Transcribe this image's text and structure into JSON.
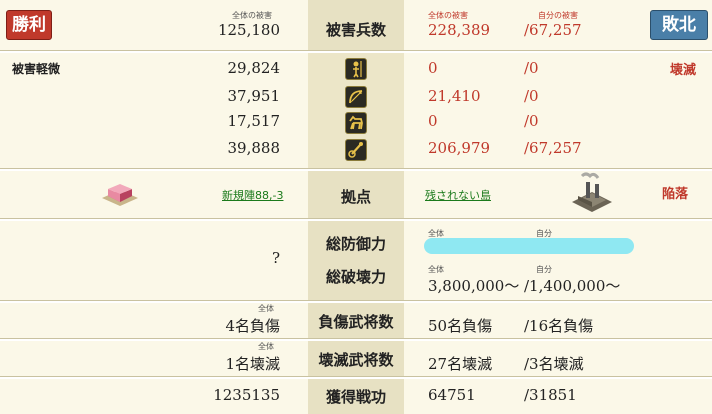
{
  "header": {
    "win_badge": "勝利",
    "lose_badge": "敗北",
    "total_damage_caption": "全体の被害",
    "total_damage_value": "125,180",
    "center_label": "被害兵数",
    "right_total_caption": "全体の被害",
    "right_self_caption": "自分の被害",
    "right_total_value": "228,389",
    "right_self_value": "/67,257"
  },
  "units": {
    "left_status": "被害軽微",
    "right_status": "壊滅",
    "rows": [
      {
        "icon": "spearman-icon",
        "left": "29,824",
        "right_total": "0",
        "right_self": "/0"
      },
      {
        "icon": "archer-bow-icon",
        "left": "37,951",
        "right_total": "21,410",
        "right_self": "/0"
      },
      {
        "icon": "cavalry-horse-icon",
        "left": "17,517",
        "right_total": "0",
        "right_self": "/0"
      },
      {
        "icon": "siege-weapon-icon",
        "left": "39,888",
        "right_total": "206,979",
        "right_self": "/67,257"
      }
    ]
  },
  "base": {
    "left_link": "新規陣88,-3",
    "center_label": "拠点",
    "right_link": "残されない島",
    "right_status": "陥落"
  },
  "defense": {
    "left_value": "?",
    "defense_label": "総防御力",
    "destroy_label": "総破壊力",
    "total_caption": "全体",
    "self_caption": "自分",
    "destroy_total_caption": "全体",
    "destroy_self_caption": "自分",
    "destroy_total": "3,800,000～",
    "destroy_self": "/1,400,000～"
  },
  "injured": {
    "left_caption": "全体",
    "left_value": "4名負傷",
    "label": "負傷武将数",
    "right_total": "50名負傷",
    "right_self": "/16名負傷"
  },
  "destroyed": {
    "left_caption": "全体",
    "left_value": "1名壊滅",
    "label": "壊滅武将数",
    "right_total": "27名壊滅",
    "right_self": "/3名壊滅"
  },
  "merit": {
    "left_value": "1235135",
    "label": "獲得戦功",
    "right_total": "64751",
    "right_self": "/31851"
  },
  "colors": {
    "win_red": "#c0392b",
    "lose_blue": "#4a7fa8",
    "redacted_cyan": "#8fe8f2",
    "link_green": "#1b7a1b"
  }
}
